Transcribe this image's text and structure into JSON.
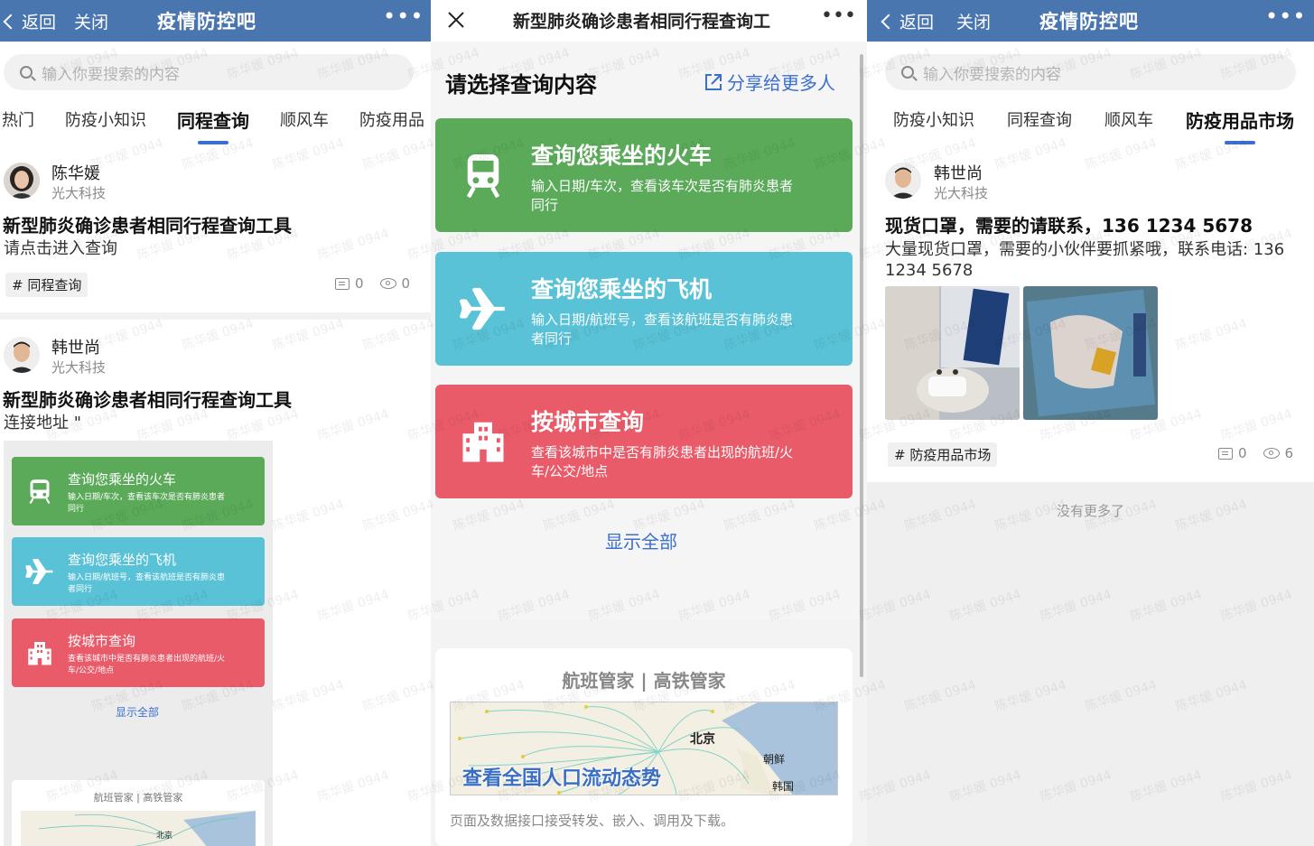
{
  "left": {
    "back": "返回",
    "close": "关闭",
    "title": "疫情防控吧",
    "more": "•••",
    "search_placeholder": "输入你要搜索的内容",
    "tabs": [
      "热门",
      "防疫小知识",
      "同程查询",
      "顺风车",
      "防疫用品"
    ],
    "posts": [
      {
        "author": "陈华媛",
        "company": "光大科技",
        "title": "新型肺炎确诊患者相同行程查询工具",
        "body": "请点击进入查询",
        "tag": "# 同程查询",
        "comments": "0",
        "views": "0"
      },
      {
        "author": "韩世尚",
        "company": "光大科技",
        "title": "新型肺炎确诊患者相同行程查询工具",
        "body": "连接地址 \""
      }
    ],
    "mini": {
      "cards": [
        {
          "title": "查询您乘坐的火车",
          "desc": "输入日期/车次，查看该车次是否有肺炎患者同行"
        },
        {
          "title": "查询您乘坐的飞机",
          "desc": "输入日期/航班号，查看该航班是否有肺炎患者同行"
        },
        {
          "title": "按城市查询",
          "desc": "查看该城市中是否有肺炎患者出现的航班/火车/公交/地点"
        }
      ],
      "show_all": "显示全部",
      "banner_title": "航班管家 | 高铁管家",
      "map_beijing": "北京"
    }
  },
  "middle": {
    "title": "新型肺炎确诊患者相同行程查询工",
    "more": "•••",
    "heading": "请选择查询内容",
    "share": "分享给更多人",
    "cards": [
      {
        "title": "查询您乘坐的火车",
        "desc": "输入日期/车次，查看该车次是否有肺炎患者同行",
        "color": "#5aaa5a",
        "icon": "train-icon"
      },
      {
        "title": "查询您乘坐的飞机",
        "desc": "输入日期/航班号，查看该航班是否有肺炎患者同行",
        "color": "#59c2d6",
        "icon": "plane-icon"
      },
      {
        "title": "按城市查询",
        "desc": "查看该城市中是否有肺炎患者出现的航班/火车/公交/地点",
        "color": "#ea5b6a",
        "icon": "building-icon"
      }
    ],
    "show_all": "显示全部",
    "banner": {
      "title": "航班管家 | 高铁管家",
      "map_text": "查看全国人口流动态势",
      "beijing": "北京",
      "korea_n": "朝鲜",
      "korea_s": "韩国",
      "footer": "页面及数据接口接受转发、嵌入、调用及下载。"
    }
  },
  "right": {
    "back": "返回",
    "close": "关闭",
    "title": "疫情防控吧",
    "more": "•••",
    "search_placeholder": "输入你要搜索的内容",
    "tabs": [
      "防疫小知识",
      "同程查询",
      "顺风车",
      "防疫用品市场"
    ],
    "post": {
      "author": "韩世尚",
      "company": "光大科技",
      "title": "现货口罩，需要的请联系，136 1234 5678",
      "body": "大量现货口罩，需要的小伙伴要抓紧哦，联系电话: 136 1234 5678",
      "tag": "# 防疫用品市场",
      "comments": "0",
      "views": "6"
    },
    "no_more": "没有更多了"
  },
  "watermark": "陈华媛 0944",
  "colors": {
    "header": "#4a76b0",
    "accent": "#3b6fce",
    "green": "#5aaa5a",
    "blue": "#59c2d6",
    "red": "#ea5b6a"
  }
}
